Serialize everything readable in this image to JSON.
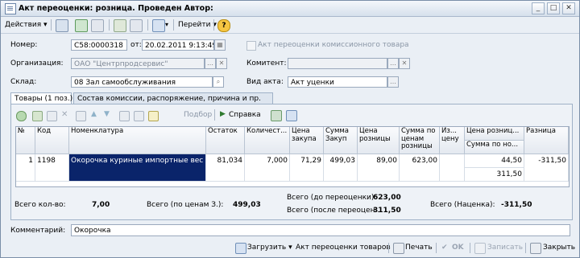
{
  "window": {
    "title": "Акт переоценки: розница. Проведен   Автор:"
  },
  "toolbar": {
    "actions_label": "Действия",
    "goto_label": "Перейти"
  },
  "header": {
    "number_label": "Номер:",
    "number_value": "С58:0000318",
    "date_label": "от:",
    "date_value": "20.02.2011  9:13:49",
    "commission_label": "Акт переоценки комиссионного товара",
    "org_label": "Организация:",
    "org_value": "ОАО \"Центрпродсервис\"",
    "contractor_label": "Комитент:",
    "contractor_value": "",
    "warehouse_label": "Склад:",
    "warehouse_value": "08 Зал самообслуживания",
    "act_type_label": "Вид акта:",
    "act_type_value": "Акт уценки"
  },
  "tabs": [
    {
      "label": "Товары (1 поз.)"
    },
    {
      "label": "Состав комиссии, распоряжение, причина и пр."
    }
  ],
  "grid_toolbar": {
    "select_label": "Подбор",
    "help_label": "Справка"
  },
  "table": {
    "columns": [
      {
        "label": "№"
      },
      {
        "label": "Код"
      },
      {
        "label": "Номенклатура"
      },
      {
        "label": "Остаток"
      },
      {
        "label": "Количест..."
      },
      {
        "label": "Цена закупа"
      },
      {
        "label": "Сумма Закуп"
      },
      {
        "label": "Цена розницы"
      },
      {
        "label": "Сумма по ценам розницы"
      },
      {
        "label": "Из... цену"
      },
      {
        "label": "Цена розниц..."
      },
      {
        "label": "Сумма по но..."
      },
      {
        "label": "Разница"
      }
    ],
    "rows": [
      {
        "num": "1",
        "code": "1198",
        "name": "Окорочка куриные импортные вес",
        "remainder": "81,034",
        "qty": "7,000",
        "purchase_price": "71,29",
        "purchase_sum": "499,03",
        "retail_price": "89,00",
        "retail_sum": "623,00",
        "change": "",
        "new_price": "44,50",
        "new_sum": "311,50",
        "diff": "-311,50"
      }
    ]
  },
  "totals": {
    "qty_label": "Всего кол-во:",
    "qty_value": "7,00",
    "purchase_label": "Всего (по ценам З.):",
    "purchase_value": "499,03",
    "before_label": "Всего (до переоценки):",
    "before_value": "623,00",
    "after_label": "Всего (после переоцен...",
    "after_value": "311,50",
    "markup_label": "Всего (Наценка):",
    "markup_value": "-311,50"
  },
  "comment": {
    "label": "Комментарий:",
    "value": "Окорочка"
  },
  "bottom": {
    "load_label": "Загрузить",
    "act_label": "Акт переоценки товаров",
    "print_label": "Печать",
    "ok_label": "OK",
    "save_label": "Записать",
    "close_label": "Закрыть"
  },
  "colors": {
    "selection": "#0a246a",
    "accent": "#2f7a2f",
    "title_bg": "#dbe4ee"
  }
}
